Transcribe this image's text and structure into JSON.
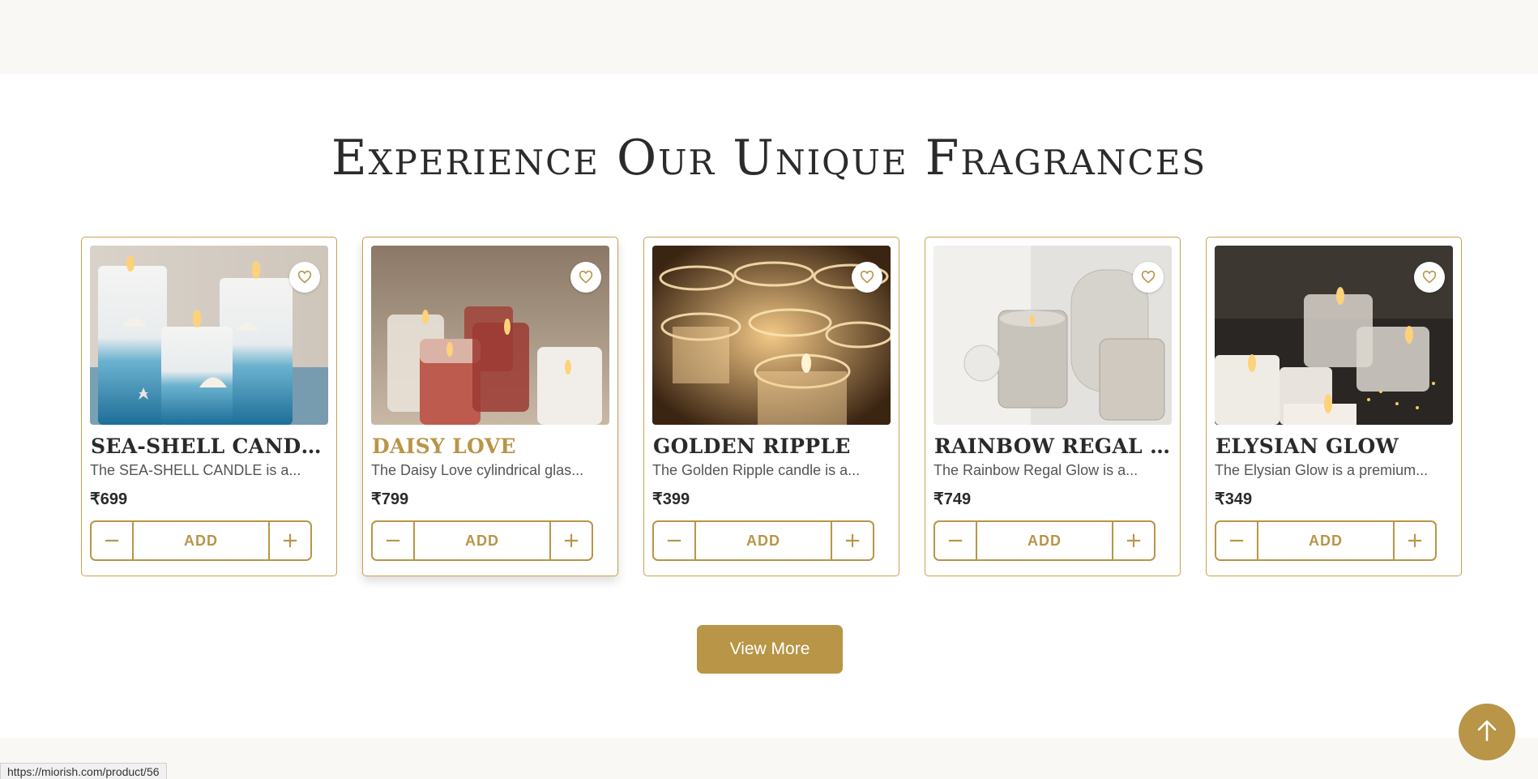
{
  "section": {
    "title": "Experience Our Unique Fragrances",
    "view_more_label": "View More"
  },
  "products": [
    {
      "name": "SEA-SHELL CANDLE",
      "description": "The SEA-SHELL CANDLE is a...",
      "price": "₹699",
      "add_label": "ADD",
      "minus_icon": "minus-icon",
      "plus_icon": "plus-icon",
      "wishlist_icon": "heart-icon"
    },
    {
      "name": "DAISY LOVE",
      "description": "The Daisy Love cylindrical glas...",
      "price": "₹799",
      "add_label": "ADD",
      "minus_icon": "minus-icon",
      "plus_icon": "plus-icon",
      "wishlist_icon": "heart-icon"
    },
    {
      "name": "GOLDEN RIPPLE",
      "description": "The Golden Ripple candle is a...",
      "price": "₹399",
      "add_label": "ADD",
      "minus_icon": "minus-icon",
      "plus_icon": "plus-icon",
      "wishlist_icon": "heart-icon"
    },
    {
      "name": "RAINBOW REGAL G...",
      "description": "The Rainbow Regal Glow is a...",
      "price": "₹749",
      "add_label": "ADD",
      "minus_icon": "minus-icon",
      "plus_icon": "plus-icon",
      "wishlist_icon": "heart-icon"
    },
    {
      "name": "ELYSIAN GLOW",
      "description": "The Elysian Glow is a premium...",
      "price": "₹349",
      "add_label": "ADD",
      "minus_icon": "minus-icon",
      "plus_icon": "plus-icon",
      "wishlist_icon": "heart-icon"
    }
  ],
  "status_bar": {
    "url": "https://miorish.com/product/56"
  },
  "colors": {
    "accent": "#b89547",
    "card_border": "#c9a24a",
    "band": "#f9f8f4",
    "text": "#2a2a2a"
  },
  "icons": {
    "scroll_top": "arrow-up-icon"
  }
}
